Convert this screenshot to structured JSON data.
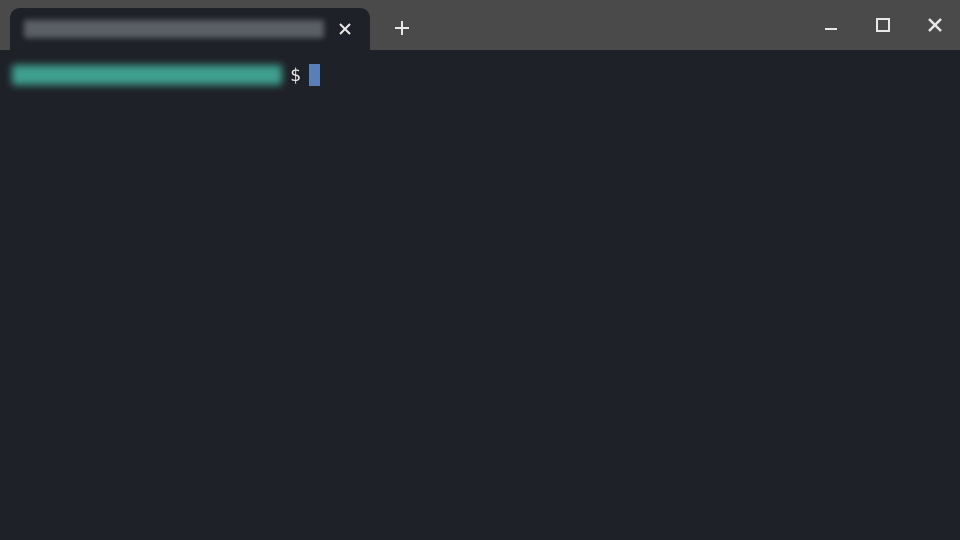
{
  "tab": {
    "title": "[redacted]"
  },
  "window_controls": {
    "minimize": "minimize",
    "maximize": "maximize",
    "close": "close"
  },
  "terminal": {
    "prompt_redacted": "[redacted]",
    "prompt_symbol": "$",
    "input_value": ""
  },
  "colors": {
    "titlebar_bg": "#4a4a4a",
    "terminal_bg": "#1e2127",
    "prompt_redacted_color": "#3fa08f",
    "cursor_color": "#5a7fb8"
  }
}
